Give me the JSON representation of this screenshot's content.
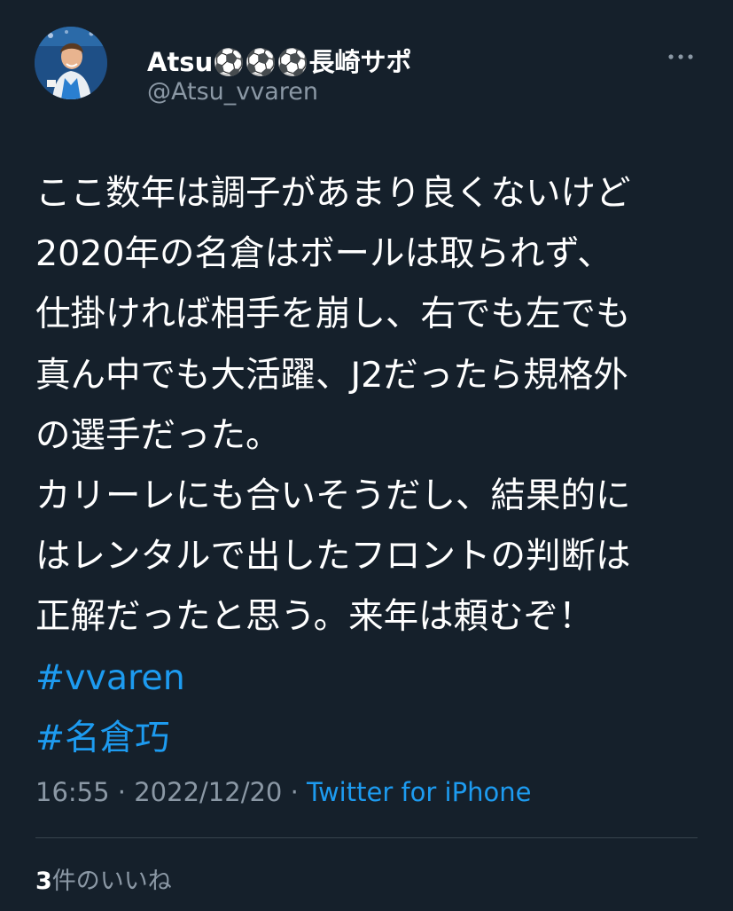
{
  "tweet": {
    "author": {
      "display_name": "Atsu⚽️⚽️⚽️長崎サポ",
      "handle": "@Atsu_vvaren",
      "avatar_icon": "profile-photo-icon"
    },
    "menu_icon": "more-horizontal-icon",
    "text_lines": [
      "ここ数年は調子があまり良くないけど",
      "2020年の名倉はボールは取られず、",
      "仕掛ければ相手を崩し、右でも左でも",
      "真ん中でも大活躍、J2だったら規格外",
      "の選手だった。",
      "カリーレにも合いそうだし、結果的に",
      "はレンタルで出したフロントの判断は",
      "正解だったと思う。来年は頼むぞ！"
    ],
    "hashtags": [
      "#vvaren",
      "#名倉巧"
    ],
    "time": "16:55",
    "separator": "·",
    "date": "2022/12/20",
    "source": "Twitter for iPhone",
    "likes": {
      "count": "3",
      "label": "件のいいね"
    }
  },
  "colors": {
    "background": "#15202b",
    "text": "#ffffff",
    "secondary_text": "#8b98a5",
    "link": "#1d9bf0",
    "divider": "#38444d"
  }
}
